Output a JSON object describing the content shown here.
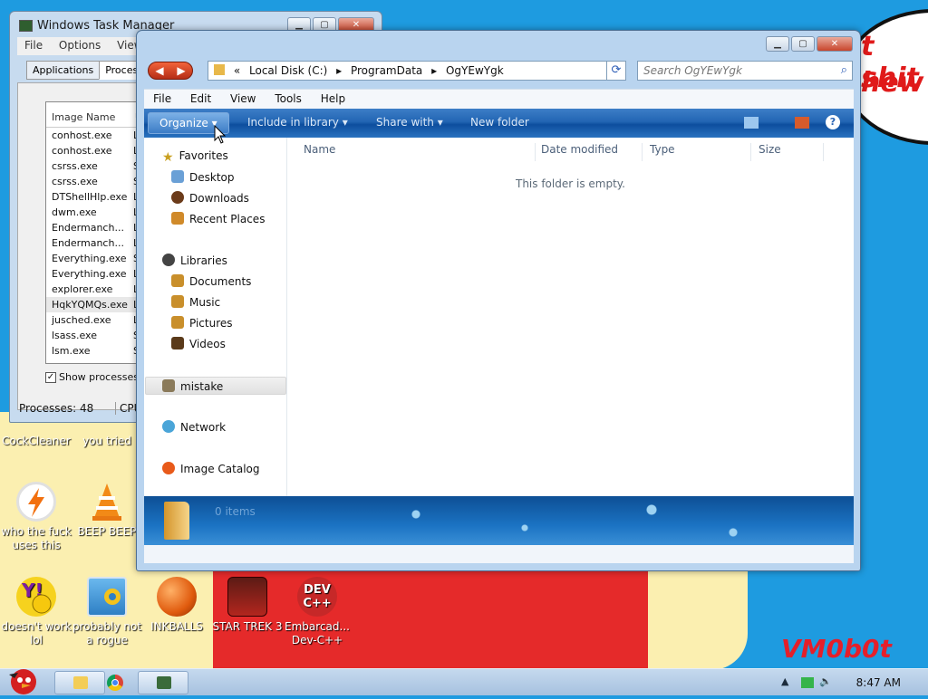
{
  "desktop": {
    "bubble_lines": [
      "t shit",
      "hew"
    ],
    "watermark": "VM0b0t",
    "icons": [
      {
        "label": "CockCleaner",
        "color": "#d23a2a"
      },
      {
        "label": "you tried",
        "color": "#d23a2a"
      },
      {
        "label": "who the fuck uses this",
        "color": "#f7f7f7"
      },
      {
        "label": "BEEP BEEP",
        "color": "#f08a1c"
      },
      {
        "label": "doesn't work lol",
        "color": "#7b1fa2"
      },
      {
        "label": "probably not a rogue",
        "color": "#4aa3e0"
      },
      {
        "label": "INKBALLS",
        "color": "#e86a1a"
      },
      {
        "label": "STAR TREK 3",
        "color": "#b3261e"
      },
      {
        "label": "Embarcad... Dev-C++",
        "color": "#c62828"
      }
    ],
    "dev_icon_text": "DEV\nC++"
  },
  "taskmgr": {
    "title": "Windows Task Manager",
    "menu": [
      "File",
      "Options",
      "View"
    ],
    "tabs": [
      "Applications",
      "Processes"
    ],
    "columns": [
      "Image Name",
      "Us"
    ],
    "processes": [
      {
        "name": "conhost.exe",
        "user": "LO"
      },
      {
        "name": "conhost.exe",
        "user": "LO"
      },
      {
        "name": "csrss.exe",
        "user": "SY"
      },
      {
        "name": "csrss.exe",
        "user": "SY"
      },
      {
        "name": "DTShellHlp.exe",
        "user": "LO"
      },
      {
        "name": "dwm.exe",
        "user": "LO"
      },
      {
        "name": "Endermanch...",
        "user": "LO"
      },
      {
        "name": "Endermanch...",
        "user": "LO"
      },
      {
        "name": "Everything.exe",
        "user": "SY"
      },
      {
        "name": "Everything.exe",
        "user": "LO"
      },
      {
        "name": "explorer.exe",
        "user": "LO"
      },
      {
        "name": "HqkYQMQs.exe",
        "user": "LO"
      },
      {
        "name": "jusched.exe",
        "user": "LO"
      },
      {
        "name": "lsass.exe",
        "user": "SY"
      },
      {
        "name": "lsm.exe",
        "user": "SY"
      }
    ],
    "show_all_label": "Show processes fro",
    "status_processes": "Processes: 48",
    "status_cpu": "CPU"
  },
  "explorer": {
    "address": {
      "chevron": "«",
      "parts": [
        "Local Disk (C:)",
        "ProgramData",
        "OgYEwYgk"
      ]
    },
    "search_placeholder": "Search OgYEwYgk",
    "menu": [
      "File",
      "Edit",
      "View",
      "Tools",
      "Help"
    ],
    "commands": {
      "organize": "Organize",
      "include": "Include in library",
      "share": "Share with",
      "new_folder": "New folder"
    },
    "nav": {
      "favorites": "Favorites",
      "fav_items": [
        "Desktop",
        "Downloads",
        "Recent Places"
      ],
      "libraries": "Libraries",
      "lib_items": [
        "Documents",
        "Music",
        "Pictures",
        "Videos"
      ],
      "mistake": "mistake",
      "network": "Network",
      "image_catalog": "Image Catalog"
    },
    "columns": [
      "Name",
      "Date modified",
      "Type",
      "Size"
    ],
    "empty_message": "This folder is empty.",
    "item_count": "0 items"
  },
  "taskbar": {
    "clock": "8:47 AM"
  }
}
